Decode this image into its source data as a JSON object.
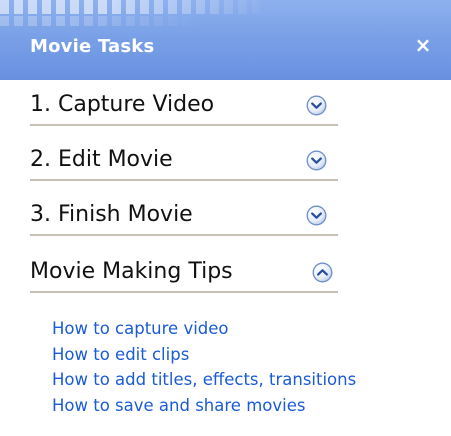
{
  "panel": {
    "title": "Movie Tasks",
    "close_glyph": "×",
    "close_icon": "close-icon",
    "header_color": "#7aa1e7",
    "link_color": "#1a5bd6",
    "underline_color": "#c6c3b6"
  },
  "sections": [
    {
      "label": "1. Capture Video",
      "expanded": false,
      "icon": "chevron-down-icon"
    },
    {
      "label": "2. Edit Movie",
      "expanded": false,
      "icon": "chevron-down-icon"
    },
    {
      "label": "3. Finish Movie",
      "expanded": false,
      "icon": "chevron-down-icon"
    },
    {
      "label": "Movie Making Tips",
      "expanded": true,
      "icon": "chevron-up-icon"
    }
  ],
  "tips": {
    "links": [
      "How to capture video",
      "How to edit clips",
      "How to add titles, effects, transitions",
      "How to save and share movies"
    ]
  }
}
